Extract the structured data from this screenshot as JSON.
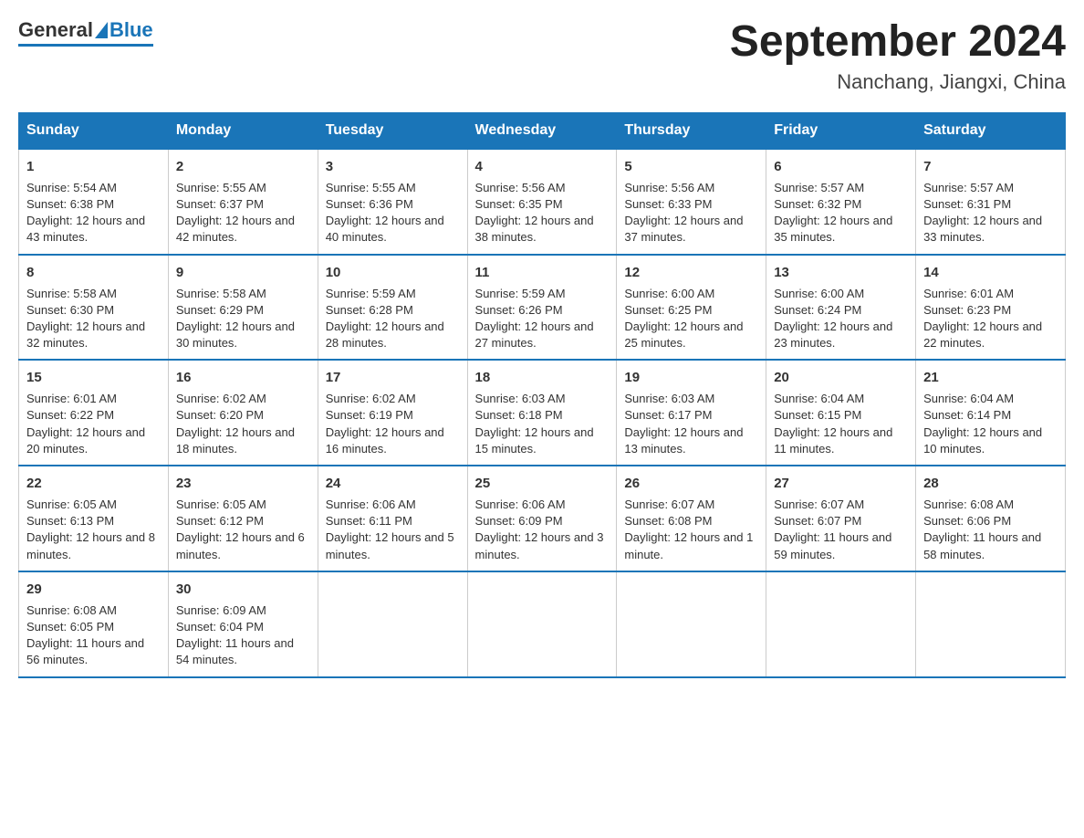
{
  "logo": {
    "general": "General",
    "blue": "Blue"
  },
  "title": {
    "month_year": "September 2024",
    "location": "Nanchang, Jiangxi, China"
  },
  "weekdays": [
    "Sunday",
    "Monday",
    "Tuesday",
    "Wednesday",
    "Thursday",
    "Friday",
    "Saturday"
  ],
  "weeks": [
    [
      {
        "day": "1",
        "sunrise": "5:54 AM",
        "sunset": "6:38 PM",
        "daylight": "12 hours and 43 minutes."
      },
      {
        "day": "2",
        "sunrise": "5:55 AM",
        "sunset": "6:37 PM",
        "daylight": "12 hours and 42 minutes."
      },
      {
        "day": "3",
        "sunrise": "5:55 AM",
        "sunset": "6:36 PM",
        "daylight": "12 hours and 40 minutes."
      },
      {
        "day": "4",
        "sunrise": "5:56 AM",
        "sunset": "6:35 PM",
        "daylight": "12 hours and 38 minutes."
      },
      {
        "day": "5",
        "sunrise": "5:56 AM",
        "sunset": "6:33 PM",
        "daylight": "12 hours and 37 minutes."
      },
      {
        "day": "6",
        "sunrise": "5:57 AM",
        "sunset": "6:32 PM",
        "daylight": "12 hours and 35 minutes."
      },
      {
        "day": "7",
        "sunrise": "5:57 AM",
        "sunset": "6:31 PM",
        "daylight": "12 hours and 33 minutes."
      }
    ],
    [
      {
        "day": "8",
        "sunrise": "5:58 AM",
        "sunset": "6:30 PM",
        "daylight": "12 hours and 32 minutes."
      },
      {
        "day": "9",
        "sunrise": "5:58 AM",
        "sunset": "6:29 PM",
        "daylight": "12 hours and 30 minutes."
      },
      {
        "day": "10",
        "sunrise": "5:59 AM",
        "sunset": "6:28 PM",
        "daylight": "12 hours and 28 minutes."
      },
      {
        "day": "11",
        "sunrise": "5:59 AM",
        "sunset": "6:26 PM",
        "daylight": "12 hours and 27 minutes."
      },
      {
        "day": "12",
        "sunrise": "6:00 AM",
        "sunset": "6:25 PM",
        "daylight": "12 hours and 25 minutes."
      },
      {
        "day": "13",
        "sunrise": "6:00 AM",
        "sunset": "6:24 PM",
        "daylight": "12 hours and 23 minutes."
      },
      {
        "day": "14",
        "sunrise": "6:01 AM",
        "sunset": "6:23 PM",
        "daylight": "12 hours and 22 minutes."
      }
    ],
    [
      {
        "day": "15",
        "sunrise": "6:01 AM",
        "sunset": "6:22 PM",
        "daylight": "12 hours and 20 minutes."
      },
      {
        "day": "16",
        "sunrise": "6:02 AM",
        "sunset": "6:20 PM",
        "daylight": "12 hours and 18 minutes."
      },
      {
        "day": "17",
        "sunrise": "6:02 AM",
        "sunset": "6:19 PM",
        "daylight": "12 hours and 16 minutes."
      },
      {
        "day": "18",
        "sunrise": "6:03 AM",
        "sunset": "6:18 PM",
        "daylight": "12 hours and 15 minutes."
      },
      {
        "day": "19",
        "sunrise": "6:03 AM",
        "sunset": "6:17 PM",
        "daylight": "12 hours and 13 minutes."
      },
      {
        "day": "20",
        "sunrise": "6:04 AM",
        "sunset": "6:15 PM",
        "daylight": "12 hours and 11 minutes."
      },
      {
        "day": "21",
        "sunrise": "6:04 AM",
        "sunset": "6:14 PM",
        "daylight": "12 hours and 10 minutes."
      }
    ],
    [
      {
        "day": "22",
        "sunrise": "6:05 AM",
        "sunset": "6:13 PM",
        "daylight": "12 hours and 8 minutes."
      },
      {
        "day": "23",
        "sunrise": "6:05 AM",
        "sunset": "6:12 PM",
        "daylight": "12 hours and 6 minutes."
      },
      {
        "day": "24",
        "sunrise": "6:06 AM",
        "sunset": "6:11 PM",
        "daylight": "12 hours and 5 minutes."
      },
      {
        "day": "25",
        "sunrise": "6:06 AM",
        "sunset": "6:09 PM",
        "daylight": "12 hours and 3 minutes."
      },
      {
        "day": "26",
        "sunrise": "6:07 AM",
        "sunset": "6:08 PM",
        "daylight": "12 hours and 1 minute."
      },
      {
        "day": "27",
        "sunrise": "6:07 AM",
        "sunset": "6:07 PM",
        "daylight": "11 hours and 59 minutes."
      },
      {
        "day": "28",
        "sunrise": "6:08 AM",
        "sunset": "6:06 PM",
        "daylight": "11 hours and 58 minutes."
      }
    ],
    [
      {
        "day": "29",
        "sunrise": "6:08 AM",
        "sunset": "6:05 PM",
        "daylight": "11 hours and 56 minutes."
      },
      {
        "day": "30",
        "sunrise": "6:09 AM",
        "sunset": "6:04 PM",
        "daylight": "11 hours and 54 minutes."
      },
      null,
      null,
      null,
      null,
      null
    ]
  ],
  "cell_labels": {
    "sunrise": "Sunrise:",
    "sunset": "Sunset:",
    "daylight": "Daylight:"
  }
}
